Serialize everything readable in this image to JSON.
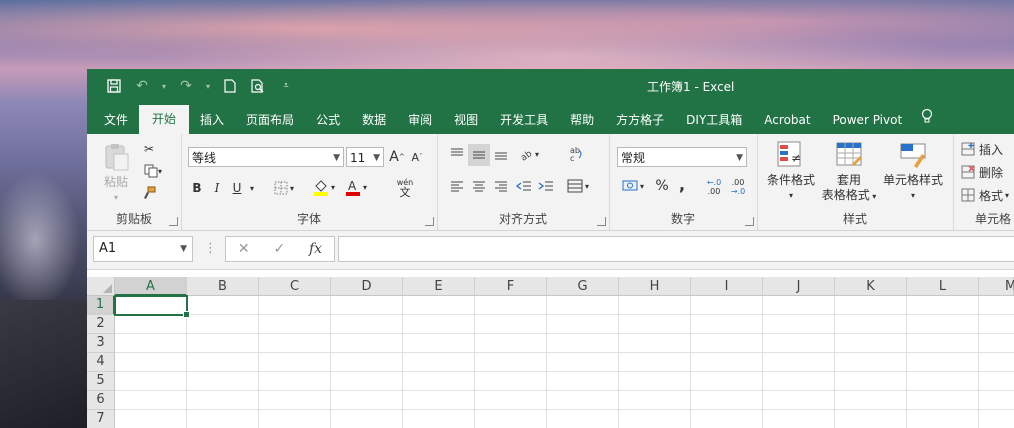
{
  "window": {
    "title": "工作簿1  -  Excel"
  },
  "qat": [
    "save-icon",
    "undo-icon",
    "redo-icon",
    "new-file-icon",
    "print-preview-icon",
    "customize-qat-icon"
  ],
  "tabs": [
    {
      "label": "文件"
    },
    {
      "label": "开始",
      "active": true
    },
    {
      "label": "插入"
    },
    {
      "label": "页面布局"
    },
    {
      "label": "公式"
    },
    {
      "label": "数据"
    },
    {
      "label": "审阅"
    },
    {
      "label": "视图"
    },
    {
      "label": "开发工具"
    },
    {
      "label": "帮助"
    },
    {
      "label": "方方格子"
    },
    {
      "label": "DIY工具箱"
    },
    {
      "label": "Acrobat"
    },
    {
      "label": "Power Pivot"
    }
  ],
  "ribbon": {
    "clipboard": {
      "label": "剪贴板",
      "paste": "粘贴"
    },
    "font": {
      "label": "字体",
      "name": "等线",
      "size": "11",
      "bold": "B",
      "italic": "I",
      "underline": "U",
      "phonetic": "wén",
      "phonetic_sub": "文",
      "grow": "A",
      "shrink": "A"
    },
    "align": {
      "label": "对齐方式"
    },
    "number": {
      "label": "数字",
      "format": "常规",
      "percent": "%",
      "comma": ",",
      "inc_decimal": ".00",
      "dec_decimal": ".0"
    },
    "styles": {
      "label": "样式",
      "cond_format": "条件格式",
      "table_format_1": "套用",
      "table_format_2": "表格格式",
      "cell_styles": "单元格样式"
    },
    "cells": {
      "label": "单元格",
      "insert": "插入",
      "delete": "删除",
      "format": "格式"
    }
  },
  "formula_bar": {
    "name_box": "A1",
    "fx": "fx",
    "value": ""
  },
  "grid": {
    "columns": [
      "A",
      "B",
      "C",
      "D",
      "E",
      "F",
      "G",
      "H",
      "I",
      "J",
      "K",
      "L",
      "M"
    ],
    "rows": [
      "1",
      "2",
      "3",
      "4",
      "5",
      "6",
      "7"
    ],
    "active_cell": "A1"
  }
}
